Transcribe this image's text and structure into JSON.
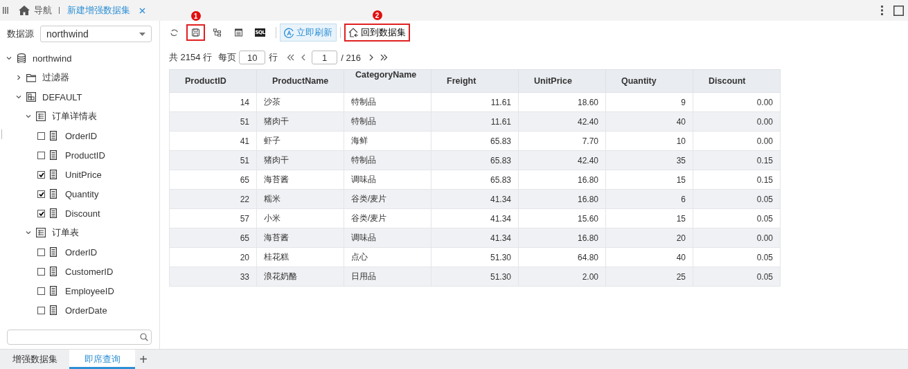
{
  "top_bar": {
    "nav_label": "导航",
    "tabs": [
      {
        "label": "新建增强数据集",
        "selected": true
      }
    ]
  },
  "sidebar": {
    "datasource_label": "数据源",
    "datasource_value": "northwind",
    "tree": [
      {
        "kind": "database",
        "label": "northwind",
        "expanded": true,
        "children": [
          {
            "kind": "folder",
            "label": "过滤器",
            "expanded": false
          },
          {
            "kind": "schema",
            "label": "DEFAULT",
            "expanded": true,
            "children": [
              {
                "kind": "table",
                "label": "订单详情表",
                "expanded": true,
                "children": [
                  {
                    "kind": "field",
                    "label": "OrderID",
                    "checked": false
                  },
                  {
                    "kind": "field",
                    "label": "ProductID",
                    "checked": false
                  },
                  {
                    "kind": "field",
                    "label": "UnitPrice",
                    "checked": true
                  },
                  {
                    "kind": "field",
                    "label": "Quantity",
                    "checked": true
                  },
                  {
                    "kind": "field",
                    "label": "Discount",
                    "checked": true
                  }
                ]
              },
              {
                "kind": "table",
                "label": "订单表",
                "expanded": true,
                "children": [
                  {
                    "kind": "field",
                    "label": "OrderID",
                    "checked": false
                  },
                  {
                    "kind": "field",
                    "label": "CustomerID",
                    "checked": false
                  },
                  {
                    "kind": "field",
                    "label": "EmployeeID",
                    "checked": false
                  },
                  {
                    "kind": "field",
                    "label": "OrderDate",
                    "checked": false
                  }
                ]
              }
            ]
          }
        ]
      }
    ]
  },
  "toolbar": {
    "items": [
      {
        "kind": "refresh",
        "active": false,
        "highlighted": false
      },
      {
        "kind": "save",
        "active": false,
        "highlighted": true,
        "marker": "1"
      },
      {
        "kind": "hierarchy",
        "active": false,
        "highlighted": false
      },
      {
        "kind": "form",
        "active": false,
        "highlighted": false
      },
      {
        "kind": "sql",
        "active": false,
        "highlighted": false,
        "icon_text": "SQL"
      },
      {
        "kind": "separator"
      },
      {
        "kind": "refresh-now",
        "label": "立即刷新",
        "active": true,
        "highlighted": false
      },
      {
        "kind": "separator"
      },
      {
        "kind": "back",
        "label": "回到数据集",
        "active": false,
        "highlighted": true,
        "marker": "2"
      }
    ]
  },
  "pager": {
    "total": "共 2154 行",
    "per_page_label": "每页",
    "per_page": "10",
    "rows_label": "行",
    "page": "1",
    "page_count": "/ 216"
  },
  "table": {
    "columns": [
      "ProductID",
      "ProductName",
      "CategoryName",
      "Freight",
      "UnitPrice",
      "Quantity",
      "Discount"
    ],
    "rows": [
      [
        "14",
        "沙茶",
        "特制品",
        "11.61",
        "18.60",
        "9",
        "0.00"
      ],
      [
        "51",
        "猪肉干",
        "特制品",
        "11.61",
        "42.40",
        "40",
        "0.00"
      ],
      [
        "41",
        "虾子",
        "海鲜",
        "65.83",
        "7.70",
        "10",
        "0.00"
      ],
      [
        "51",
        "猪肉干",
        "特制品",
        "65.83",
        "42.40",
        "35",
        "0.15"
      ],
      [
        "65",
        "海苔酱",
        "调味品",
        "65.83",
        "16.80",
        "15",
        "0.15"
      ],
      [
        "22",
        "糯米",
        "谷类/麦片",
        "41.34",
        "16.80",
        "6",
        "0.05"
      ],
      [
        "57",
        "小米",
        "谷类/麦片",
        "41.34",
        "15.60",
        "15",
        "0.05"
      ],
      [
        "65",
        "海苔酱",
        "调味品",
        "41.34",
        "16.80",
        "20",
        "0.00"
      ],
      [
        "20",
        "桂花糕",
        "点心",
        "51.30",
        "64.80",
        "40",
        "0.05"
      ],
      [
        "33",
        "浪花奶酪",
        "日用品",
        "51.30",
        "2.00",
        "25",
        "0.05"
      ]
    ]
  },
  "bottom_tabs": {
    "tabs": [
      {
        "label": "增强数据集",
        "selected": false
      },
      {
        "label": "即席查询",
        "selected": true
      }
    ],
    "add_label": "+"
  }
}
